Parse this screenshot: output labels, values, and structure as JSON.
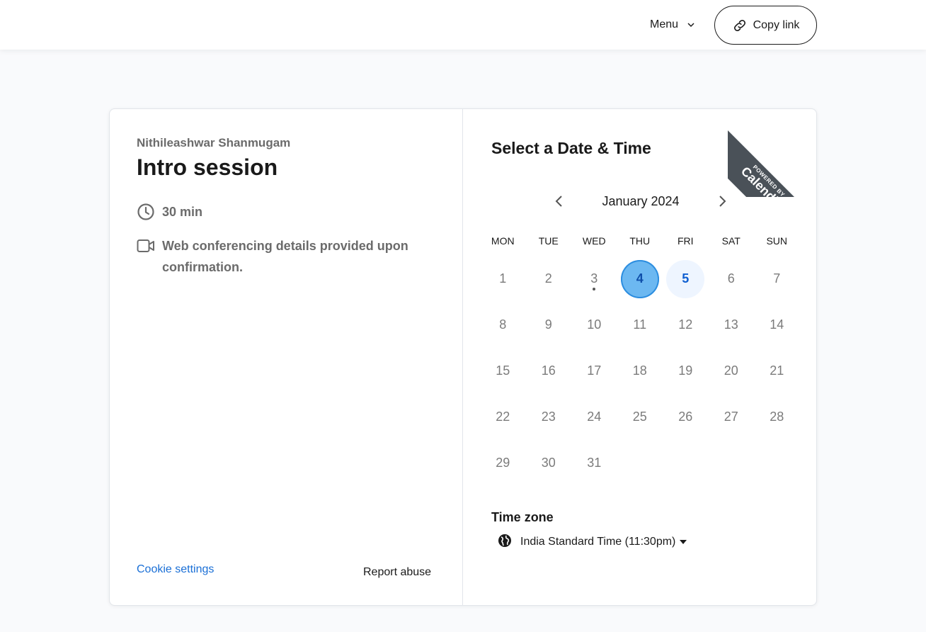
{
  "header": {
    "menu_label": "Menu",
    "copy_link_label": "Copy link"
  },
  "event": {
    "host": "Nithileashwar Shanmugam",
    "title": "Intro session",
    "duration": "30 min",
    "conferencing": "Web conferencing details provided upon confirmation."
  },
  "footer": {
    "cookie_settings": "Cookie settings",
    "report_abuse": "Report abuse"
  },
  "scheduler": {
    "title": "Select a Date & Time",
    "month_label": "January 2024",
    "weekdays": [
      "MON",
      "TUE",
      "WED",
      "THU",
      "FRI",
      "SAT",
      "SUN"
    ],
    "days": [
      {
        "label": "1",
        "state": "disabled"
      },
      {
        "label": "2",
        "state": "disabled"
      },
      {
        "label": "3",
        "state": "today"
      },
      {
        "label": "4",
        "state": "selected"
      },
      {
        "label": "5",
        "state": "available"
      },
      {
        "label": "6",
        "state": "disabled"
      },
      {
        "label": "7",
        "state": "disabled"
      },
      {
        "label": "8",
        "state": "disabled"
      },
      {
        "label": "9",
        "state": "disabled"
      },
      {
        "label": "10",
        "state": "disabled"
      },
      {
        "label": "11",
        "state": "disabled"
      },
      {
        "label": "12",
        "state": "disabled"
      },
      {
        "label": "13",
        "state": "disabled"
      },
      {
        "label": "14",
        "state": "disabled"
      },
      {
        "label": "15",
        "state": "disabled"
      },
      {
        "label": "16",
        "state": "disabled"
      },
      {
        "label": "17",
        "state": "disabled"
      },
      {
        "label": "18",
        "state": "disabled"
      },
      {
        "label": "19",
        "state": "disabled"
      },
      {
        "label": "20",
        "state": "disabled"
      },
      {
        "label": "21",
        "state": "disabled"
      },
      {
        "label": "22",
        "state": "disabled"
      },
      {
        "label": "23",
        "state": "disabled"
      },
      {
        "label": "24",
        "state": "disabled"
      },
      {
        "label": "25",
        "state": "disabled"
      },
      {
        "label": "26",
        "state": "disabled"
      },
      {
        "label": "27",
        "state": "disabled"
      },
      {
        "label": "28",
        "state": "disabled"
      },
      {
        "label": "29",
        "state": "disabled"
      },
      {
        "label": "30",
        "state": "disabled"
      },
      {
        "label": "31",
        "state": "disabled"
      }
    ],
    "timezone_label": "Time zone",
    "timezone_value": "India Standard Time (11:30pm)"
  },
  "ribbon": {
    "powered_by": "POWERED BY",
    "brand": "Calendly"
  },
  "icons": {
    "menu": "chevron-down-icon",
    "copy_link": "link-icon",
    "duration": "clock-icon",
    "conferencing": "video-camera-icon",
    "prev": "chevron-left-icon",
    "next": "chevron-right-icon",
    "timezone": "globe-icon"
  },
  "colors": {
    "accent": "#0f5fd1",
    "selected_fill": "#6cb8f1",
    "available_fill": "#eef5ff",
    "ribbon": "#4a5158"
  }
}
